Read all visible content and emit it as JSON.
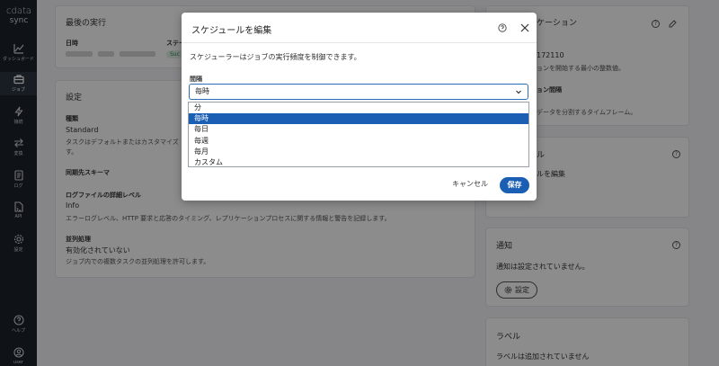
{
  "brand": {
    "line1": "cdata",
    "line2": "sync"
  },
  "nav": [
    {
      "key": "dashboard",
      "label": "ダッシュボード",
      "icon": "chart-line-icon"
    },
    {
      "key": "jobs",
      "label": "ジョブ",
      "icon": "briefcase-icon"
    },
    {
      "key": "connections",
      "label": "接続",
      "icon": "bolt-icon"
    },
    {
      "key": "transforms",
      "label": "変換",
      "icon": "swap-arrows-icon"
    },
    {
      "key": "logs",
      "label": "ログ",
      "icon": "document-icon"
    },
    {
      "key": "api",
      "label": "API",
      "icon": "api-file-icon"
    },
    {
      "key": "settings",
      "label": "設定",
      "icon": "gear-icon"
    },
    {
      "key": "help",
      "label": "ヘルプ",
      "icon": "question-circle-icon"
    },
    {
      "key": "user",
      "label": "user",
      "icon": "user-circle-icon"
    }
  ],
  "background": {
    "last_run": {
      "title": "最後の実行",
      "date_label": "日時",
      "status_label": "ステー",
      "status_value": "Suc"
    },
    "settings": {
      "title": "設定",
      "type_label": "種類",
      "type_value": "Standard",
      "type_desc1": "タスクはデフォルトまたはカスタマイズ",
      "type_desc2": "す。",
      "schema_label": "同期先スキーマ",
      "log_label": "ログファイルの詳細レベル",
      "log_value": "Info",
      "log_desc": "エラーログレベル、HTTP 要求と応答のタイミング、レプリケーションプロセスに関する情報と警告を記録します。",
      "parallel_label": "並列処理",
      "parallel_value": "有効化されていない",
      "parallel_desc": "ジョブ内での複数タスクの並列処理を許可します。"
    },
    "replication": {
      "title": "ケーション",
      "number": "172110",
      "start_text": "ョンを開始する最小の整数値。",
      "interval_label": "ョン間隔",
      "interval_desc": "データを分割するタイムフレーム。"
    },
    "schedule": {
      "title": "ル",
      "edit_text": "ルを編集"
    },
    "notify": {
      "title": "通知",
      "status": "通知は設定されていません。",
      "button": "設定"
    },
    "labels": {
      "title": "ラベル",
      "status": "ラベルは追加されていません"
    }
  },
  "modal": {
    "title": "スケジュールを編集",
    "description": "スケジューラーはジョブの実行頻度を制御できます。",
    "interval_label": "間隔",
    "interval_value": "毎時",
    "options": [
      "分",
      "毎時",
      "毎日",
      "毎週",
      "毎月",
      "カスタム"
    ],
    "selected_index": 1,
    "cancel": "キャンセル",
    "save": "保存"
  },
  "colors": {
    "primary": "#1a5fb4",
    "nav_bg": "#1d232c",
    "overlay": "rgba(0,0,0,0.45)"
  }
}
